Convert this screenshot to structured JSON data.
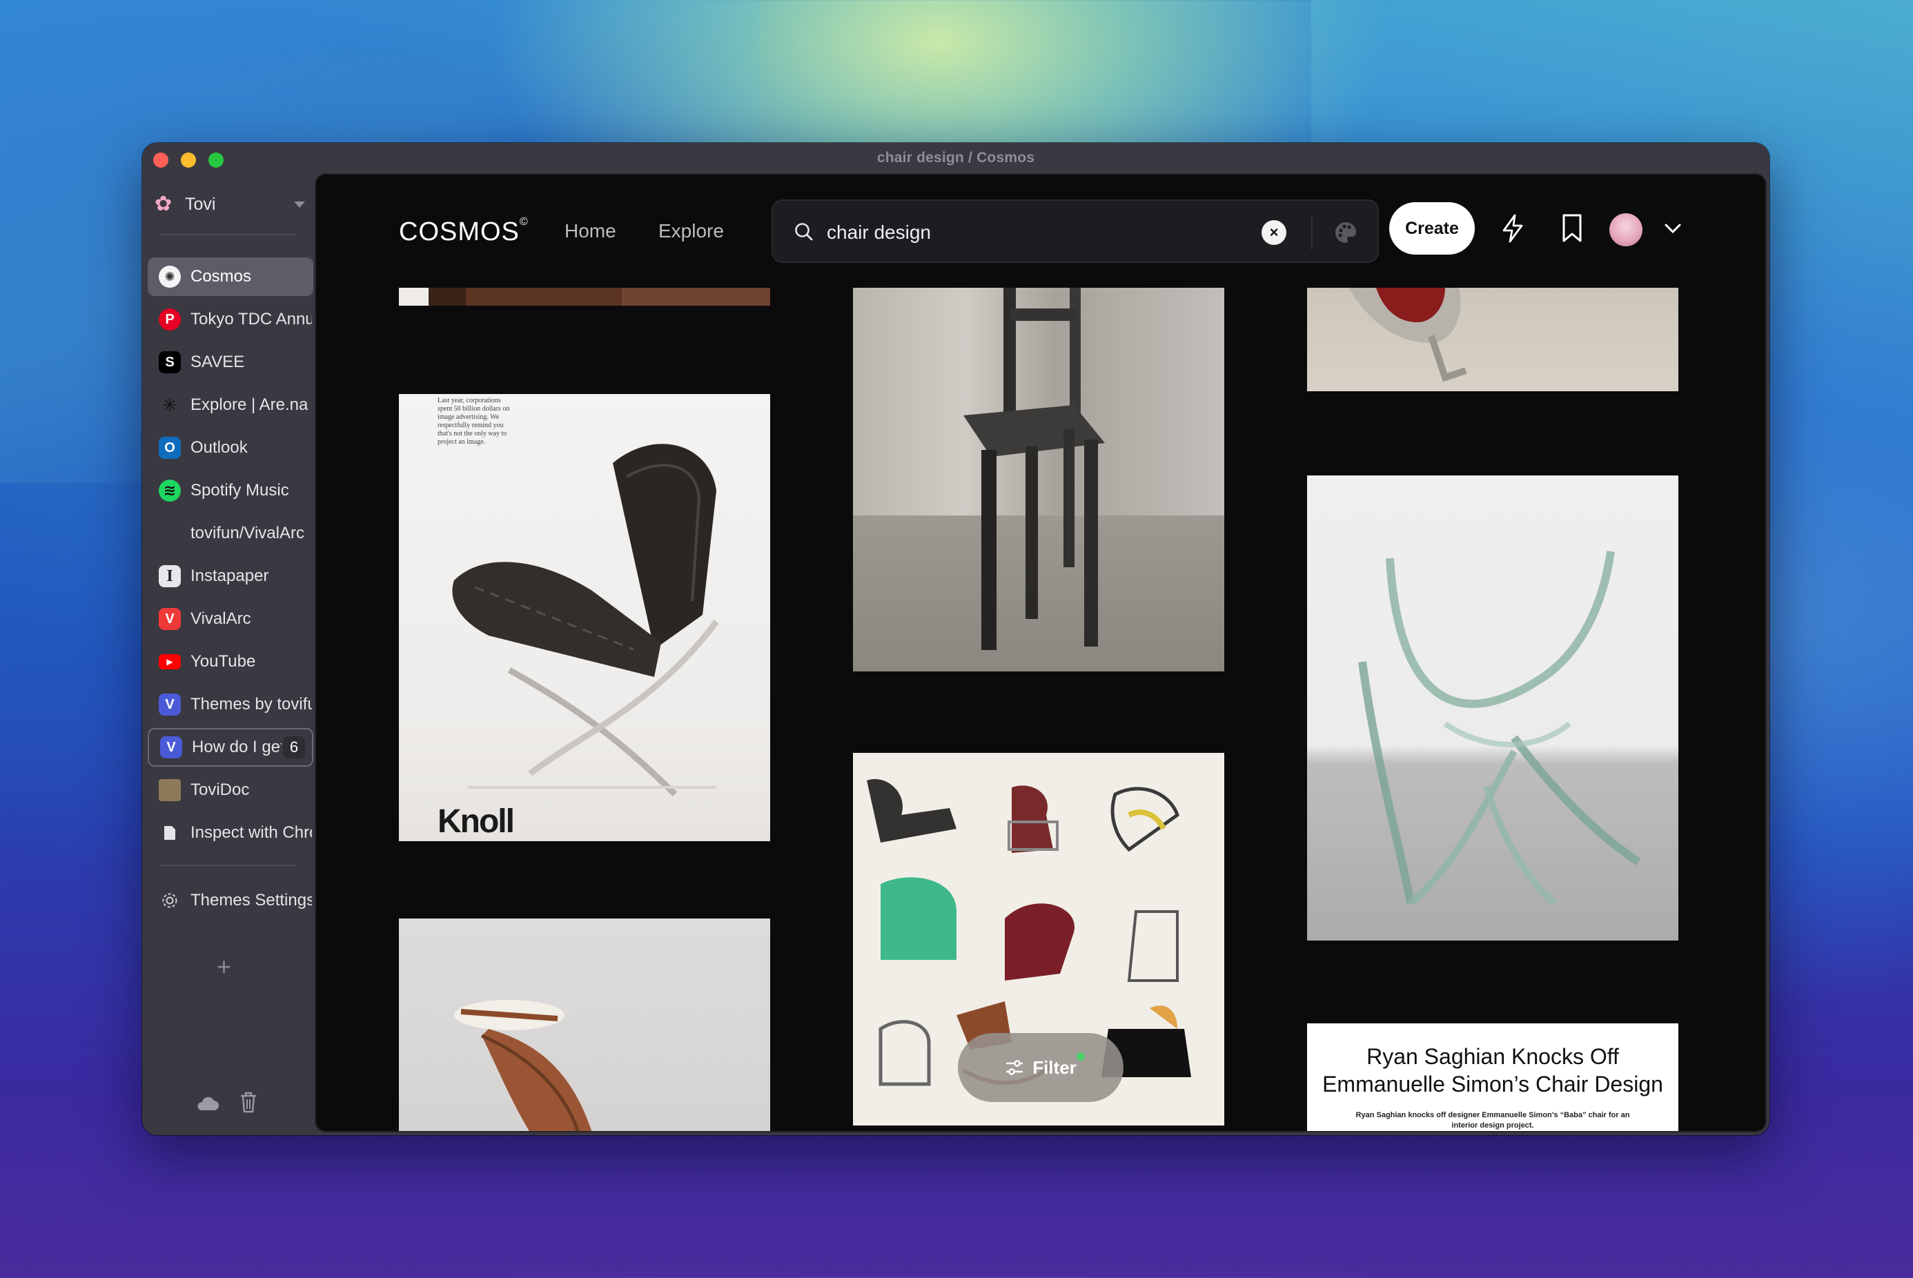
{
  "window": {
    "title": "chair design / Cosmos"
  },
  "sidebar": {
    "profile_name": "Tovi",
    "tabs": [
      {
        "label": "Cosmos",
        "icon": "cosmos-icon",
        "active": true
      },
      {
        "label": "Tokyo TDC Annual",
        "icon": "pinterest-icon"
      },
      {
        "label": "SAVEE",
        "icon": "savee-icon"
      },
      {
        "label": "Explore | Are.na",
        "icon": "arena-icon"
      },
      {
        "label": "Outlook",
        "icon": "outlook-icon"
      },
      {
        "label": "Spotify Music",
        "icon": "spotify-icon"
      },
      {
        "label": "tovifun/VivalArc",
        "icon": "github-icon"
      },
      {
        "label": "Instapaper",
        "icon": "instapaper-icon"
      },
      {
        "label": "VivalArc",
        "icon": "vivaldi-icon"
      },
      {
        "label": "YouTube",
        "icon": "youtube-icon"
      },
      {
        "label": "Themes by tovifun",
        "icon": "vivaldi-icon"
      },
      {
        "label": "How do I get",
        "icon": "vivaldi-icon",
        "badge": "6"
      },
      {
        "label": "ToviDoc",
        "icon": "tovidoc-icon"
      },
      {
        "label": "Inspect with Chrome",
        "icon": "document-icon"
      }
    ],
    "settings_label": "Themes Settings",
    "add_icon": "plus-icon",
    "footer_icons": [
      "cloud-icon",
      "trash-icon"
    ]
  },
  "topnav": {
    "logo": "COSMOS",
    "logo_mark": "©",
    "links": [
      "Home",
      "Explore"
    ],
    "search_value": "chair design",
    "create_label": "Create",
    "icons": [
      "search-icon",
      "clear-icon",
      "palette-icon",
      "lightning-icon",
      "bookmark-icon",
      "avatar",
      "chevron-down-icon"
    ]
  },
  "cards": {
    "knoll_ad_copy": "Last year, corporations spent 50 billion dollars on image advertising. We respectfully remind you that's not the only way to project an image.",
    "knoll_logo": "Knoll",
    "article_title_line1": "Ryan Saghian Knocks Off",
    "article_title_line2": "Emmanuelle Simon’s Chair Design",
    "article_sub": "Ryan Saghian knocks off designer Emmanuelle Simon’s “Baba” chair for an interior design project."
  },
  "filter_label": "Filter",
  "colors": {
    "accent_green": "#4cd16a",
    "content_bg": "#0b0b0c",
    "sidebar_bg": "#3a3840"
  }
}
